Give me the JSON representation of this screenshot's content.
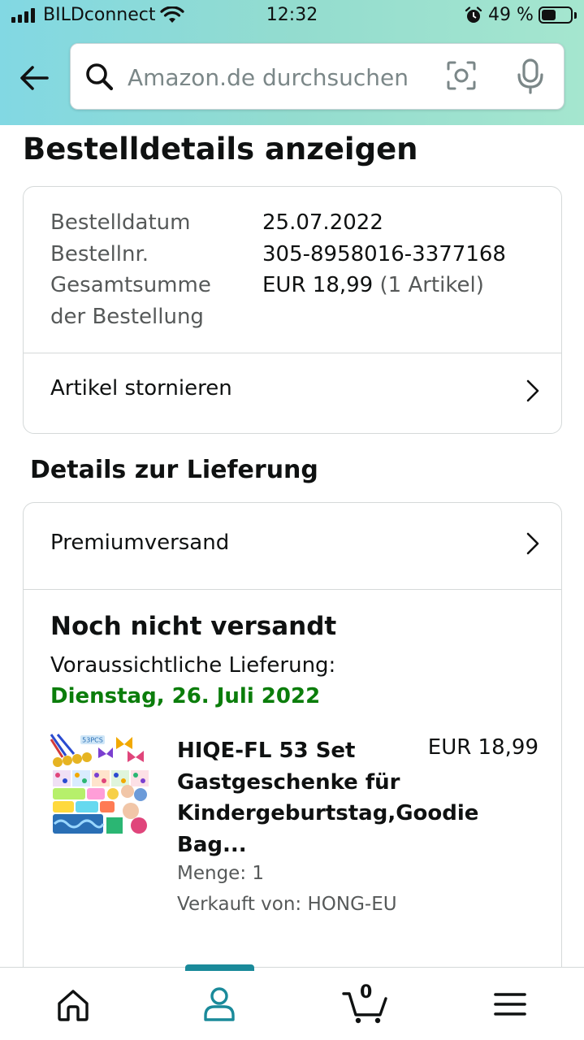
{
  "status_bar": {
    "carrier": "BILDconnect",
    "time": "12:32",
    "battery_percent": "49 %",
    "battery_level": 0.49
  },
  "search": {
    "placeholder": "Amazon.de durchsuchen"
  },
  "page": {
    "title": "Bestelldetails anzeigen"
  },
  "order": {
    "date_label": "Bestelldatum",
    "date_value": "25.07.2022",
    "number_label": "Bestellnr.",
    "number_value": "305-8958016-3377168",
    "total_label_line1": "Gesamtsumme",
    "total_label_line2": "der Bestellung",
    "total_value": "EUR 18,99",
    "total_items": "(1 Artikel)",
    "cancel_label": "Artikel stornieren"
  },
  "delivery": {
    "section_title": "Details zur Lieferung",
    "shipping_method": "Premiumversand",
    "status": "Noch nicht versandt",
    "eta_label": "Voraussichtliche Lieferung:",
    "eta_date": "Dienstag, 26. Juli 2022",
    "product": {
      "title": "HIQE-FL 53 Set Gastgeschenke für Kindergeburtstag,Goodie Bag...",
      "price": "EUR 18,99",
      "quantity": "Menge: 1",
      "seller": "Verkauft von: HONG-EU",
      "thumb_badge": "53PCS"
    }
  },
  "bottom_nav": {
    "cart_count": "0",
    "active_tab": "account"
  },
  "colors": {
    "delivery_green": "#0b7d0b",
    "nav_accent": "#1a8a9a"
  }
}
